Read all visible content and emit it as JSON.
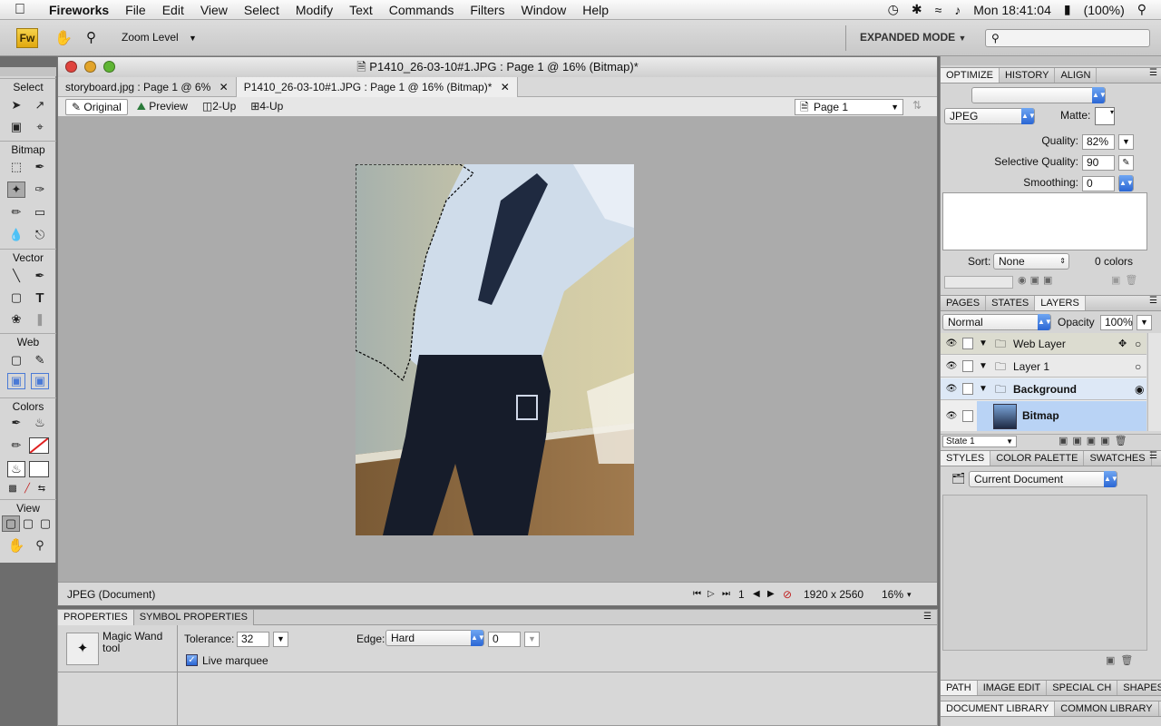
{
  "menubar": {
    "app": "Fireworks",
    "items": [
      "File",
      "Edit",
      "View",
      "Select",
      "Modify",
      "Text",
      "Commands",
      "Filters",
      "Window",
      "Help"
    ],
    "clock": "Mon 18:41:04",
    "battery": "(100%)"
  },
  "appbar": {
    "logo": "Fw",
    "zoom_label": "Zoom Level",
    "mode": "EXPANDED MODE",
    "search_placeholder": ""
  },
  "tools": {
    "sections": [
      "Select",
      "Bitmap",
      "Vector",
      "Web",
      "Colors",
      "View"
    ]
  },
  "document": {
    "title": "P1410_26-03-10#1.JPG : Page 1 @ 16% (Bitmap)*",
    "tabs": [
      "storyboard.jpg : Page 1 @ 6%",
      "P1410_26-03-10#1.JPG : Page 1 @ 16% (Bitmap)*"
    ],
    "views": [
      "Original",
      "Preview",
      "2-Up",
      "4-Up"
    ],
    "page": "Page 1",
    "status_left": "JPEG (Document)",
    "frame": "1",
    "dimensions": "1920 x 2560",
    "zoom": "16%"
  },
  "properties": {
    "tabs": [
      "PROPERTIES",
      "SYMBOL PROPERTIES"
    ],
    "tool_name": "Magic Wand",
    "tool_sub": "tool",
    "tolerance_label": "Tolerance:",
    "tolerance": "32",
    "edge_label": "Edge:",
    "edge": "Hard",
    "edge_value": "0",
    "live_marquee": "Live marquee"
  },
  "optimize": {
    "tabs": [
      "OPTIMIZE",
      "HISTORY",
      "ALIGN"
    ],
    "format": "JPEG",
    "matte_label": "Matte:",
    "quality_label": "Quality:",
    "quality": "82%",
    "sel_quality_label": "Selective Quality:",
    "sel_quality": "90",
    "smoothing_label": "Smoothing:",
    "smoothing": "0",
    "sort_label": "Sort:",
    "sort": "None",
    "colors": "0 colors"
  },
  "layers": {
    "tabs": [
      "PAGES",
      "STATES",
      "LAYERS"
    ],
    "blend": "Normal",
    "opacity_label": "Opacity",
    "opacity": "100%",
    "rows": [
      "Web Layer",
      "Layer 1",
      "Background",
      "Bitmap"
    ],
    "state": "State 1"
  },
  "styles": {
    "tabs": [
      "STYLES",
      "COLOR PALETTE",
      "SWATCHES"
    ],
    "source": "Current Document"
  },
  "bottom_tabs": {
    "row1": [
      "PATH",
      "IMAGE EDIT",
      "SPECIAL CH",
      "SHAPES"
    ],
    "row2": [
      "DOCUMENT LIBRARY",
      "COMMON LIBRARY"
    ]
  }
}
